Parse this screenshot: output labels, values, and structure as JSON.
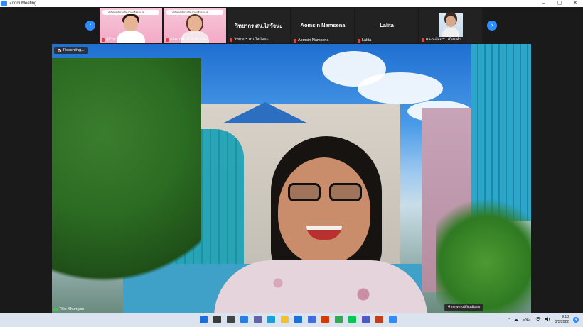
{
  "window": {
    "title": "Zoom Meeting",
    "controls": [
      "–",
      "▢",
      "✕"
    ]
  },
  "gallery": {
    "prev_arrow": "‹",
    "next_arrow": "›",
    "tiles": [
      {
        "name": "ผู้อำนวยการบัตกต...",
        "banner": "เตรียมพร้อมเปิดภาคเรียนแบบ...",
        "type": "video"
      },
      {
        "name": "ผลิตภาษาก์ กฤชะแสน",
        "banner": "เตรียมพร้อมเปิดภาคเรียนแบบ...",
        "type": "video"
      },
      {
        "name": "วิทยากร ศน.ไสวัจนะ",
        "label": "วิทยากร ศน.ไสวัจนะ",
        "type": "text"
      },
      {
        "name": "Aomsin Namsena",
        "label": "Aomsin Namsena",
        "type": "text"
      },
      {
        "name": "Lalita",
        "label": "Lalita",
        "type": "text"
      },
      {
        "name": "03-5-อัจฉรา เกือนคำ",
        "type": "photo"
      }
    ]
  },
  "main_video": {
    "recording_label": "Recording...",
    "speaker_name": "Thip Khumyoo"
  },
  "notification": {
    "text": "4 new notifications"
  },
  "taskbar": {
    "apps": [
      {
        "name": "windows",
        "color": "#1b6fe0"
      },
      {
        "name": "search",
        "color": "#3a3a3a"
      },
      {
        "name": "task-view",
        "color": "#444444"
      },
      {
        "name": "widgets",
        "color": "#2a7de1"
      },
      {
        "name": "chat",
        "color": "#6264a7"
      },
      {
        "name": "edge",
        "color": "#1aa0d8"
      },
      {
        "name": "file-explorer",
        "color": "#f2c12e"
      },
      {
        "name": "mail",
        "color": "#1a73d9"
      },
      {
        "name": "photos",
        "color": "#3d6ee6"
      },
      {
        "name": "office",
        "color": "#d83b01"
      },
      {
        "name": "chrome",
        "color": "#34a853"
      },
      {
        "name": "line",
        "color": "#06c755"
      },
      {
        "name": "teams",
        "color": "#5059c9"
      },
      {
        "name": "powerpoint",
        "color": "#c43e1c"
      },
      {
        "name": "zoom",
        "color": "#2d8cff"
      }
    ],
    "tray": {
      "chevron": "^",
      "cloud": "☁",
      "language": "ENG",
      "wifi": "wifi",
      "volume": "volume",
      "time": "9:13",
      "date": "3/5/2022",
      "notification_count": "4"
    }
  },
  "colors": {
    "accent": "#2d8cff",
    "mic_muted": "#e0433b",
    "taskbar_bg": "#dbe3ee"
  }
}
